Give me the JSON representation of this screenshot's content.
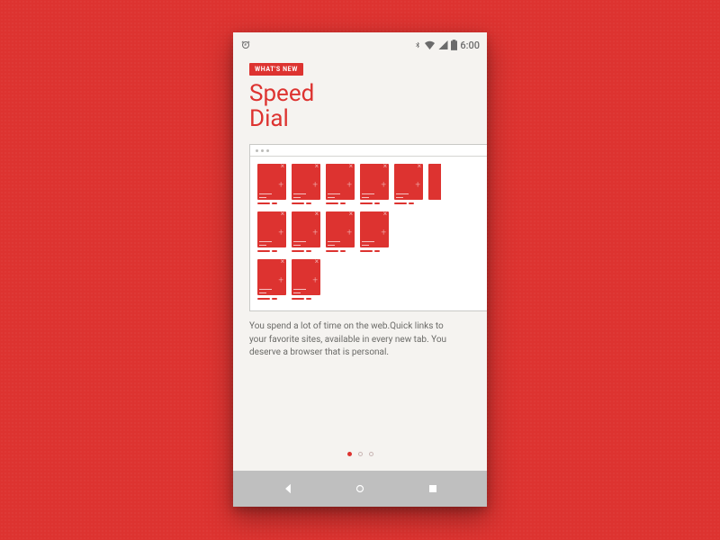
{
  "colors": {
    "accent": "#dd3330",
    "background": "#f5f3f0",
    "navbar": "#bfbfbf"
  },
  "statusbar": {
    "time": "6:00",
    "icons": [
      "alarm-icon",
      "bluetooth-icon",
      "wifi-icon",
      "signal-icon",
      "battery-icon"
    ]
  },
  "onboarding": {
    "badge_label": "WHAT'S NEW",
    "title": "Speed\nDial",
    "body": "You spend a lot of time on the web.Quick links to your favorite sites, available in every new tab. You deserve a browser that is personal.",
    "illustration": {
      "type": "browser-window",
      "rows": [
        {
          "tiles": 6,
          "last_clipped": true
        },
        {
          "tiles": 4,
          "last_clipped": false
        },
        {
          "tiles": 2,
          "last_clipped": false
        }
      ]
    },
    "pager": {
      "count": 3,
      "active_index": 0
    }
  },
  "navbar": {
    "buttons": [
      "back",
      "home",
      "recents"
    ]
  }
}
